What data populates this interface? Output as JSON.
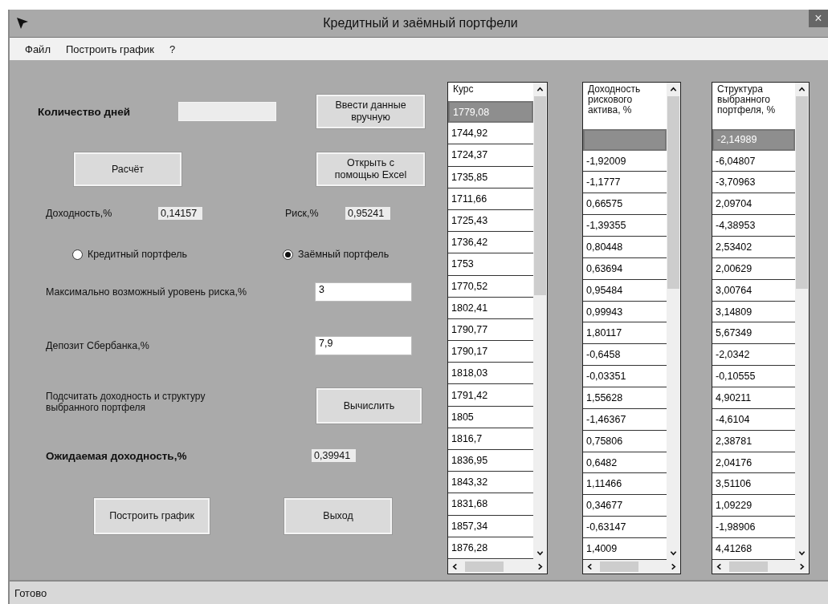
{
  "window": {
    "title": "Кредитный и заёмный портфели",
    "close": "×"
  },
  "menu": [
    "Файл",
    "Построить график",
    "?"
  ],
  "form": {
    "days_label": "Количество дней",
    "manual_button": "Ввести данные вручную",
    "calc_button": "Расчёт",
    "excel_button": "Открыть с помощью Excel",
    "return_label": "Доходность,%",
    "return_value": "0,14157",
    "risk_label": "Риск,%",
    "risk_value": "0,95241",
    "portfolio_options": [
      {
        "label": "Кредитный портфель",
        "selected": false
      },
      {
        "label": "Заёмный портфель",
        "selected": true
      }
    ],
    "max_risk_label": "Максимально возможный уровень риска,%",
    "max_risk_value": "3",
    "deposit_label": "Депозит Сбербанка,%",
    "deposit_value": "7,9",
    "compute_label": "Подсчитать доходность и структуру выбранного портфеля",
    "compute_button": "Вычислить",
    "expected_label": "Ожидаемая доходность,%",
    "expected_value": "0,39941",
    "chart_button": "Построить график",
    "exit_button": "Выход"
  },
  "lists": [
    {
      "header": "Курс",
      "rows": [
        {
          "value": "1779,08",
          "selected": true
        },
        {
          "value": "1744,92",
          "selected": false
        },
        {
          "value": "1724,37",
          "selected": false
        },
        {
          "value": "1735,85",
          "selected": false
        },
        {
          "value": "1711,66",
          "selected": false
        },
        {
          "value": "1725,43",
          "selected": false
        },
        {
          "value": "1736,42",
          "selected": false
        },
        {
          "value": "1753",
          "selected": false
        },
        {
          "value": "1770,52",
          "selected": false
        },
        {
          "value": "1802,41",
          "selected": false
        },
        {
          "value": "1790,77",
          "selected": false
        },
        {
          "value": "1790,17",
          "selected": false
        },
        {
          "value": "1818,03",
          "selected": false
        },
        {
          "value": "1791,42",
          "selected": false
        },
        {
          "value": "1805",
          "selected": false
        },
        {
          "value": "1816,7",
          "selected": false
        },
        {
          "value": "1836,95",
          "selected": false
        },
        {
          "value": "1843,32",
          "selected": false
        },
        {
          "value": "1831,68",
          "selected": false
        },
        {
          "value": "1857,34",
          "selected": false
        },
        {
          "value": "1876,28",
          "selected": false
        }
      ]
    },
    {
      "header": "Доходность рискового актива, %",
      "rows": [
        {
          "selected": true
        },
        {
          "value": "-1,92009",
          "selected": false
        },
        {
          "value": "-1,1777",
          "selected": false
        },
        {
          "value": "0,66575",
          "selected": false
        },
        {
          "value": "-1,39355",
          "selected": false
        },
        {
          "value": "0,80448",
          "selected": false
        },
        {
          "value": "0,63694",
          "selected": false
        },
        {
          "value": "0,95484",
          "selected": false
        },
        {
          "value": "0,99943",
          "selected": false
        },
        {
          "value": "1,80117",
          "selected": false
        },
        {
          "value": "-0,6458",
          "selected": false
        },
        {
          "value": "-0,03351",
          "selected": false
        },
        {
          "value": "1,55628",
          "selected": false
        },
        {
          "value": "-1,46367",
          "selected": false
        },
        {
          "value": "0,75806",
          "selected": false
        },
        {
          "value": "0,6482",
          "selected": false
        },
        {
          "value": "1,11466",
          "selected": false
        },
        {
          "value": "0,34677",
          "selected": false
        },
        {
          "value": "-0,63147",
          "selected": false
        },
        {
          "value": "1,4009",
          "selected": false
        }
      ]
    },
    {
      "header": "Структура выбранного портфеля, %",
      "rows": [
        {
          "value": "-2,14989",
          "selected": true
        },
        {
          "value": "-6,04807",
          "selected": false
        },
        {
          "value": "-3,70963",
          "selected": false
        },
        {
          "value": "2,09704",
          "selected": false
        },
        {
          "value": "-4,38953",
          "selected": false
        },
        {
          "value": "2,53402",
          "selected": false
        },
        {
          "value": "2,00629",
          "selected": false
        },
        {
          "value": "3,00764",
          "selected": false
        },
        {
          "value": "3,14809",
          "selected": false
        },
        {
          "value": "5,67349",
          "selected": false
        },
        {
          "value": "-2,0342",
          "selected": false
        },
        {
          "value": "-0,10555",
          "selected": false
        },
        {
          "value": "4,90211",
          "selected": false
        },
        {
          "value": "-4,6104",
          "selected": false
        },
        {
          "value": "2,38781",
          "selected": false
        },
        {
          "value": "2,04176",
          "selected": false
        },
        {
          "value": "3,51106",
          "selected": false
        },
        {
          "value": "1,09229",
          "selected": false
        },
        {
          "value": "-1,98906",
          "selected": false
        },
        {
          "value": "4,41268",
          "selected": false
        }
      ]
    }
  ],
  "status_bar": "Готово"
}
